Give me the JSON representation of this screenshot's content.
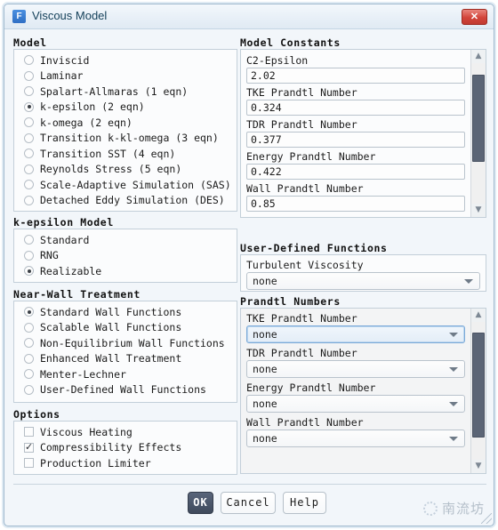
{
  "window": {
    "title": "Viscous Model",
    "icon": "fluent-app-icon",
    "icon_letter": "F",
    "close_label": "✕"
  },
  "model": {
    "group_title": "Model",
    "options": [
      {
        "label": "Inviscid",
        "selected": false
      },
      {
        "label": "Laminar",
        "selected": false
      },
      {
        "label": "Spalart-Allmaras (1 eqn)",
        "selected": false
      },
      {
        "label": "k-epsilon (2 eqn)",
        "selected": true
      },
      {
        "label": "k-omega (2 eqn)",
        "selected": false
      },
      {
        "label": "Transition k-kl-omega (3 eqn)",
        "selected": false
      },
      {
        "label": "Transition SST (4 eqn)",
        "selected": false
      },
      {
        "label": "Reynolds Stress (5 eqn)",
        "selected": false
      },
      {
        "label": "Scale-Adaptive Simulation (SAS)",
        "selected": false
      },
      {
        "label": "Detached Eddy Simulation (DES)",
        "selected": false
      }
    ]
  },
  "kepsilon_model": {
    "group_title": "k-epsilon Model",
    "options": [
      {
        "label": "Standard",
        "selected": false
      },
      {
        "label": "RNG",
        "selected": false
      },
      {
        "label": "Realizable",
        "selected": true
      }
    ]
  },
  "near_wall_treatment": {
    "group_title": "Near-Wall Treatment",
    "options": [
      {
        "label": "Standard Wall Functions",
        "selected": true
      },
      {
        "label": "Scalable Wall Functions",
        "selected": false
      },
      {
        "label": "Non-Equilibrium Wall Functions",
        "selected": false
      },
      {
        "label": "Enhanced Wall Treatment",
        "selected": false
      },
      {
        "label": "Menter-Lechner",
        "selected": false
      },
      {
        "label": "User-Defined Wall Functions",
        "selected": false
      }
    ]
  },
  "options": {
    "group_title": "Options",
    "items": [
      {
        "label": "Viscous Heating",
        "checked": false
      },
      {
        "label": "Compressibility Effects",
        "checked": true
      },
      {
        "label": "Production Limiter",
        "checked": false
      }
    ]
  },
  "model_constants": {
    "group_title": "Model Constants",
    "fields": [
      {
        "label": "C2-Epsilon",
        "value": "2.02"
      },
      {
        "label": "TKE Prandtl Number",
        "value": "0.324"
      },
      {
        "label": "TDR Prandtl Number",
        "value": "0.377"
      },
      {
        "label": "Energy Prandtl Number",
        "value": "0.422"
      },
      {
        "label": "Wall Prandtl Number",
        "value": "0.85"
      }
    ],
    "scroll": {
      "up_arrow": "▲",
      "down_arrow": "▼",
      "thumb_top_pct": 8,
      "thumb_height_pct": 62
    }
  },
  "user_defined_functions": {
    "group_title": "User-Defined Functions",
    "turbulent_viscosity": {
      "label": "Turbulent Viscosity",
      "value": "none"
    }
  },
  "prandtl_numbers": {
    "group_title": "Prandtl Numbers",
    "fields": [
      {
        "label": "TKE Prandtl Number",
        "value": "none",
        "focused": true
      },
      {
        "label": "TDR Prandtl Number",
        "value": "none",
        "focused": false
      },
      {
        "label": "Energy Prandtl Number",
        "value": "none",
        "focused": false
      },
      {
        "label": "Wall Prandtl Number",
        "value": "none",
        "focused": false
      }
    ],
    "scroll": {
      "up_arrow": "▲",
      "down_arrow": "▼",
      "thumb_top_pct": 8,
      "thumb_height_pct": 76
    }
  },
  "footer": {
    "ok_label": "OK",
    "cancel_label": "Cancel",
    "help_label": "Help"
  },
  "watermark": {
    "text": "南流坊"
  },
  "colors": {
    "dialog_bg": "#f2f6fa",
    "titlebar": "#e7eff7",
    "close_red": "#d3453b",
    "ok_button": "#3f4a5c",
    "scroll_thumb": "#5b6576",
    "focus_blue": "#7aa9d8"
  }
}
